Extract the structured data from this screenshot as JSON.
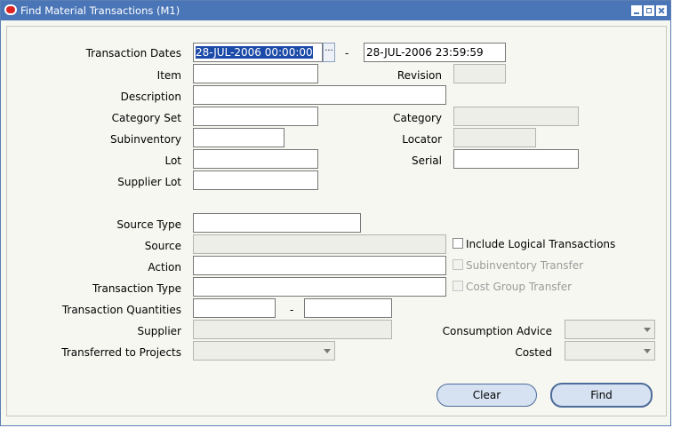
{
  "window": {
    "title": "Find Material Transactions (M1)"
  },
  "labels": {
    "transaction_dates": "Transaction Dates",
    "item": "Item",
    "revision": "Revision",
    "description": "Description",
    "category_set": "Category Set",
    "category": "Category",
    "subinventory": "Subinventory",
    "locator": "Locator",
    "lot": "Lot",
    "serial": "Serial",
    "supplier_lot": "Supplier Lot",
    "source_type": "Source Type",
    "source": "Source",
    "action": "Action",
    "transaction_type": "Transaction Type",
    "transaction_quantities": "Transaction Quantities",
    "supplier": "Supplier",
    "transferred_to_projects": "Transferred to Projects",
    "consumption_advice": "Consumption Advice",
    "costed": "Costed"
  },
  "values": {
    "date_from": "28-JUL-2006 00:00:00",
    "date_to": "28-JUL-2006 23:59:59",
    "range_separator": "-",
    "lov_glyph": "···"
  },
  "checkboxes": {
    "include_logical": "Include Logical Transactions",
    "subinventory_transfer": "Subinventory Transfer",
    "cost_group_transfer": "Cost Group Transfer"
  },
  "buttons": {
    "clear": "Clear",
    "find": "Find"
  },
  "colors": {
    "titlebar": "#4a76b8",
    "selection": "#1c4aa8"
  }
}
